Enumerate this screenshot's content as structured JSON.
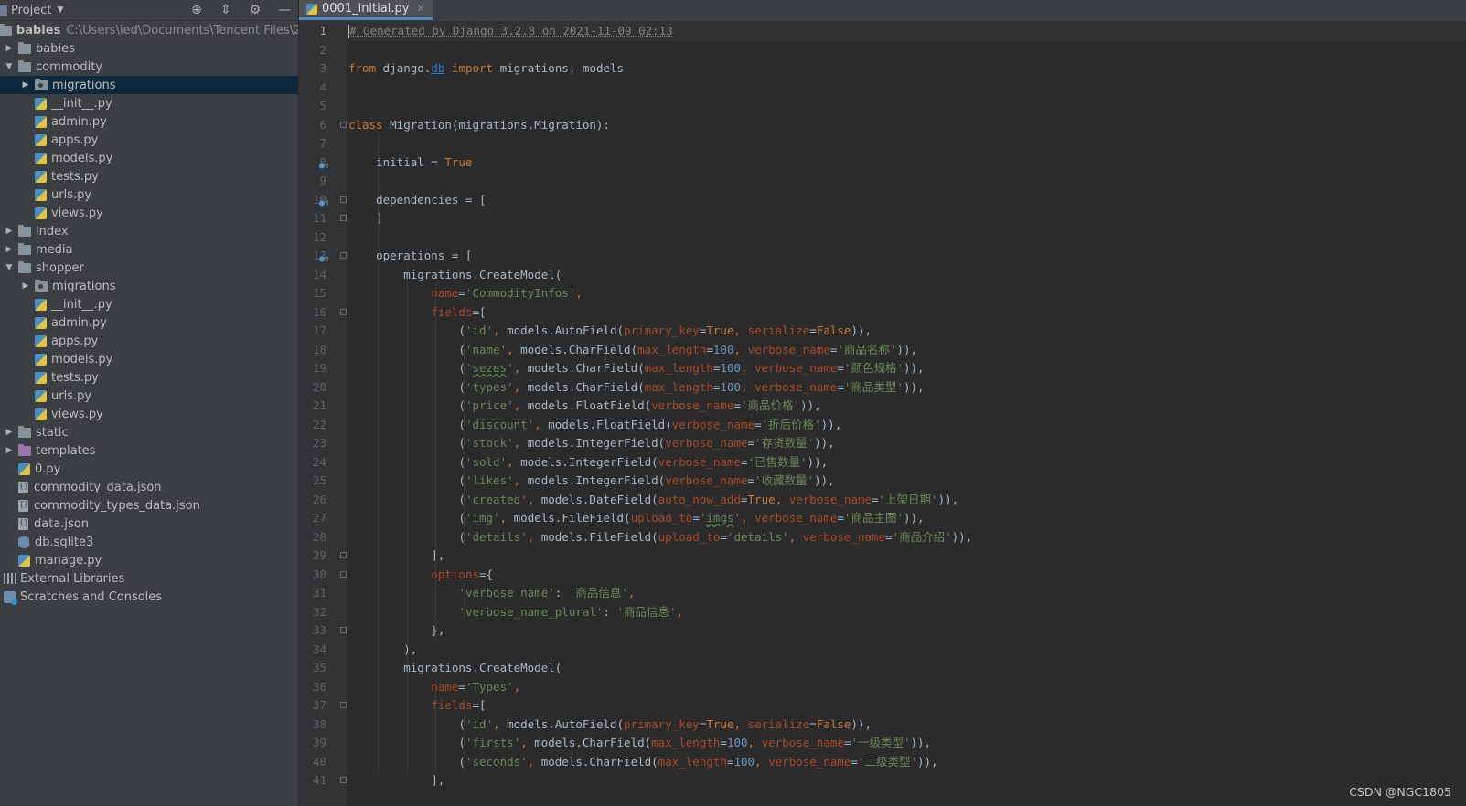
{
  "sidebar": {
    "title": "Project",
    "root_name": "babies",
    "root_path": "C:\\Users\\ied\\Documents\\Tencent Files\\2033(",
    "items": [
      {
        "label": "babies",
        "type": "folder",
        "depth": 1,
        "arrow": "right"
      },
      {
        "label": "commodity",
        "type": "folder",
        "depth": 1,
        "arrow": "down"
      },
      {
        "label": "migrations",
        "type": "pkg",
        "depth": 2,
        "arrow": "right",
        "selected": true
      },
      {
        "label": "__init__.py",
        "type": "py",
        "depth": 2
      },
      {
        "label": "admin.py",
        "type": "py",
        "depth": 2
      },
      {
        "label": "apps.py",
        "type": "py",
        "depth": 2
      },
      {
        "label": "models.py",
        "type": "py",
        "depth": 2
      },
      {
        "label": "tests.py",
        "type": "py",
        "depth": 2
      },
      {
        "label": "urls.py",
        "type": "py",
        "depth": 2
      },
      {
        "label": "views.py",
        "type": "py",
        "depth": 2
      },
      {
        "label": "index",
        "type": "folder",
        "depth": 1,
        "arrow": "right"
      },
      {
        "label": "media",
        "type": "folder",
        "depth": 1,
        "arrow": "right"
      },
      {
        "label": "shopper",
        "type": "folder",
        "depth": 1,
        "arrow": "down"
      },
      {
        "label": "migrations",
        "type": "pkg",
        "depth": 2,
        "arrow": "right"
      },
      {
        "label": "__init__.py",
        "type": "py",
        "depth": 2
      },
      {
        "label": "admin.py",
        "type": "py",
        "depth": 2
      },
      {
        "label": "apps.py",
        "type": "py",
        "depth": 2
      },
      {
        "label": "models.py",
        "type": "py",
        "depth": 2
      },
      {
        "label": "tests.py",
        "type": "py",
        "depth": 2
      },
      {
        "label": "urls.py",
        "type": "py",
        "depth": 2
      },
      {
        "label": "views.py",
        "type": "py",
        "depth": 2
      },
      {
        "label": "static",
        "type": "folder",
        "depth": 1,
        "arrow": "right"
      },
      {
        "label": "templates",
        "type": "tpl",
        "depth": 1,
        "arrow": "right"
      },
      {
        "label": "0.py",
        "type": "py",
        "depth": 1
      },
      {
        "label": "commodity_data.json",
        "type": "json",
        "depth": 1
      },
      {
        "label": "commodity_types_data.json",
        "type": "json",
        "depth": 1
      },
      {
        "label": "data.json",
        "type": "json",
        "depth": 1
      },
      {
        "label": "db.sqlite3",
        "type": "db",
        "depth": 1
      },
      {
        "label": "manage.py",
        "type": "py",
        "depth": 1
      }
    ],
    "external_libraries": "External Libraries",
    "scratches": "Scratches and Consoles"
  },
  "editor": {
    "tab_label": "0001_initial.py",
    "lines": [
      [
        [
          "com",
          "# Generated by Django 3.2.8 on 2021-11-09 02:13"
        ]
      ],
      [],
      [
        [
          "kw",
          "from "
        ],
        [
          "t",
          "django."
        ],
        [
          "link",
          "db"
        ],
        [
          "kw",
          " import "
        ],
        [
          "t",
          "migrations, models"
        ]
      ],
      [],
      [],
      [
        [
          "kw",
          "class "
        ],
        [
          "t",
          "Migration(migrations.Migration):"
        ]
      ],
      [],
      [
        [
          "t",
          "    initial = "
        ],
        [
          "kw",
          "True"
        ]
      ],
      [],
      [
        [
          "t",
          "    dependencies = ["
        ]
      ],
      [
        [
          "t",
          "    ]"
        ]
      ],
      [],
      [
        [
          "t",
          "    operations = ["
        ]
      ],
      [
        [
          "t",
          "        migrations.CreateModel("
        ]
      ],
      [
        [
          "t",
          "            "
        ],
        [
          "param",
          "name"
        ],
        [
          "t",
          "="
        ],
        [
          "str",
          "'CommodityInfos'"
        ],
        [
          "kw",
          ","
        ]
      ],
      [
        [
          "t",
          "            "
        ],
        [
          "param",
          "fields"
        ],
        [
          "t",
          "=["
        ]
      ],
      [
        [
          "t",
          "                ("
        ],
        [
          "str",
          "'id'"
        ],
        [
          "kw",
          ", "
        ],
        [
          "t",
          "models.AutoField("
        ],
        [
          "param",
          "primary_key"
        ],
        [
          "t",
          "="
        ],
        [
          "kw",
          "True"
        ],
        [
          "kw",
          ", "
        ],
        [
          "param",
          "serialize"
        ],
        [
          "t",
          "="
        ],
        [
          "kw",
          "False"
        ],
        [
          "t",
          ")),"
        ]
      ],
      [
        [
          "t",
          "                ("
        ],
        [
          "str",
          "'name'"
        ],
        [
          "kw",
          ", "
        ],
        [
          "t",
          "models.CharField("
        ],
        [
          "param",
          "max_length"
        ],
        [
          "t",
          "="
        ],
        [
          "num",
          "100"
        ],
        [
          "kw",
          ", "
        ],
        [
          "param",
          "verbose_name"
        ],
        [
          "t",
          "="
        ],
        [
          "str",
          "'商品名称'"
        ],
        [
          "t",
          ")),"
        ]
      ],
      [
        [
          "t",
          "                ("
        ],
        [
          "str",
          "'"
        ],
        [
          "wstr",
          "sezes"
        ],
        [
          "str",
          "'"
        ],
        [
          "kw",
          ", "
        ],
        [
          "t",
          "models.CharField("
        ],
        [
          "param",
          "max_length"
        ],
        [
          "t",
          "="
        ],
        [
          "num",
          "100"
        ],
        [
          "kw",
          ", "
        ],
        [
          "param",
          "verbose_name"
        ],
        [
          "t",
          "="
        ],
        [
          "str",
          "'颜色规格'"
        ],
        [
          "t",
          ")),"
        ]
      ],
      [
        [
          "t",
          "                ("
        ],
        [
          "str",
          "'types'"
        ],
        [
          "kw",
          ", "
        ],
        [
          "t",
          "models.CharField("
        ],
        [
          "param",
          "max_length"
        ],
        [
          "t",
          "="
        ],
        [
          "num",
          "100"
        ],
        [
          "kw",
          ", "
        ],
        [
          "param",
          "verbose_name"
        ],
        [
          "t",
          "="
        ],
        [
          "str",
          "'商品类型'"
        ],
        [
          "t",
          ")),"
        ]
      ],
      [
        [
          "t",
          "                ("
        ],
        [
          "str",
          "'price'"
        ],
        [
          "kw",
          ", "
        ],
        [
          "t",
          "models.FloatField("
        ],
        [
          "param",
          "verbose_name"
        ],
        [
          "t",
          "="
        ],
        [
          "str",
          "'商品价格'"
        ],
        [
          "t",
          ")),"
        ]
      ],
      [
        [
          "t",
          "                ("
        ],
        [
          "str",
          "'discount'"
        ],
        [
          "kw",
          ", "
        ],
        [
          "t",
          "models.FloatField("
        ],
        [
          "param",
          "verbose_name"
        ],
        [
          "t",
          "="
        ],
        [
          "str",
          "'折后价格'"
        ],
        [
          "t",
          ")),"
        ]
      ],
      [
        [
          "t",
          "                ("
        ],
        [
          "str",
          "'stock'"
        ],
        [
          "kw",
          ", "
        ],
        [
          "t",
          "models.IntegerField("
        ],
        [
          "param",
          "verbose_name"
        ],
        [
          "t",
          "="
        ],
        [
          "str",
          "'存货数量'"
        ],
        [
          "t",
          ")),"
        ]
      ],
      [
        [
          "t",
          "                ("
        ],
        [
          "str",
          "'sold'"
        ],
        [
          "kw",
          ", "
        ],
        [
          "t",
          "models.IntegerField("
        ],
        [
          "param",
          "verbose_name"
        ],
        [
          "t",
          "="
        ],
        [
          "str",
          "'已售数量'"
        ],
        [
          "t",
          ")),"
        ]
      ],
      [
        [
          "t",
          "                ("
        ],
        [
          "str",
          "'likes'"
        ],
        [
          "kw",
          ", "
        ],
        [
          "t",
          "models.IntegerField("
        ],
        [
          "param",
          "verbose_name"
        ],
        [
          "t",
          "="
        ],
        [
          "str",
          "'收藏数量'"
        ],
        [
          "t",
          ")),"
        ]
      ],
      [
        [
          "t",
          "                ("
        ],
        [
          "str",
          "'created'"
        ],
        [
          "kw",
          ", "
        ],
        [
          "t",
          "models.DateField("
        ],
        [
          "param",
          "auto_now_add"
        ],
        [
          "t",
          "="
        ],
        [
          "kw",
          "True"
        ],
        [
          "kw",
          ", "
        ],
        [
          "param",
          "verbose_name"
        ],
        [
          "t",
          "="
        ],
        [
          "str",
          "'上架日期'"
        ],
        [
          "t",
          ")),"
        ]
      ],
      [
        [
          "t",
          "                ("
        ],
        [
          "str",
          "'img'"
        ],
        [
          "kw",
          ", "
        ],
        [
          "t",
          "models.FileField("
        ],
        [
          "param",
          "upload_to"
        ],
        [
          "t",
          "="
        ],
        [
          "str",
          "'"
        ],
        [
          "wstr",
          "imgs"
        ],
        [
          "str",
          "'"
        ],
        [
          "kw",
          ", "
        ],
        [
          "param",
          "verbose_name"
        ],
        [
          "t",
          "="
        ],
        [
          "str",
          "'商品主图'"
        ],
        [
          "t",
          ")),"
        ]
      ],
      [
        [
          "t",
          "                ("
        ],
        [
          "str",
          "'details'"
        ],
        [
          "kw",
          ", "
        ],
        [
          "t",
          "models.FileField("
        ],
        [
          "param",
          "upload_to"
        ],
        [
          "t",
          "="
        ],
        [
          "str",
          "'details'"
        ],
        [
          "kw",
          ", "
        ],
        [
          "param",
          "verbose_name"
        ],
        [
          "t",
          "="
        ],
        [
          "str",
          "'商品介绍'"
        ],
        [
          "t",
          ")),"
        ]
      ],
      [
        [
          "t",
          "            ],"
        ]
      ],
      [
        [
          "t",
          "            "
        ],
        [
          "param",
          "options"
        ],
        [
          "t",
          "={"
        ]
      ],
      [
        [
          "t",
          "                "
        ],
        [
          "str",
          "'verbose_name'"
        ],
        [
          "t",
          ": "
        ],
        [
          "str",
          "'商品信息'"
        ],
        [
          "kw",
          ","
        ]
      ],
      [
        [
          "t",
          "                "
        ],
        [
          "str",
          "'verbose_name_plural'"
        ],
        [
          "t",
          ": "
        ],
        [
          "str",
          "'商品信息'"
        ],
        [
          "kw",
          ","
        ]
      ],
      [
        [
          "t",
          "            },"
        ]
      ],
      [
        [
          "t",
          "        ),"
        ]
      ],
      [
        [
          "t",
          "        migrations.CreateModel("
        ]
      ],
      [
        [
          "t",
          "            "
        ],
        [
          "param",
          "name"
        ],
        [
          "t",
          "="
        ],
        [
          "str",
          "'Types'"
        ],
        [
          "kw",
          ","
        ]
      ],
      [
        [
          "t",
          "            "
        ],
        [
          "param",
          "fields"
        ],
        [
          "t",
          "=["
        ]
      ],
      [
        [
          "t",
          "                ("
        ],
        [
          "str",
          "'id'"
        ],
        [
          "kw",
          ", "
        ],
        [
          "t",
          "models.AutoField("
        ],
        [
          "param",
          "primary_key"
        ],
        [
          "t",
          "="
        ],
        [
          "kw",
          "True"
        ],
        [
          "kw",
          ", "
        ],
        [
          "param",
          "serialize"
        ],
        [
          "t",
          "="
        ],
        [
          "kw",
          "False"
        ],
        [
          "t",
          ")),"
        ]
      ],
      [
        [
          "t",
          "                ("
        ],
        [
          "str",
          "'firsts'"
        ],
        [
          "kw",
          ", "
        ],
        [
          "t",
          "models.CharField("
        ],
        [
          "param",
          "max_length"
        ],
        [
          "t",
          "="
        ],
        [
          "num",
          "100"
        ],
        [
          "kw",
          ", "
        ],
        [
          "param",
          "verbose_name"
        ],
        [
          "t",
          "="
        ],
        [
          "str",
          "'一级类型'"
        ],
        [
          "t",
          ")),"
        ]
      ],
      [
        [
          "t",
          "                ("
        ],
        [
          "str",
          "'seconds'"
        ],
        [
          "kw",
          ", "
        ],
        [
          "t",
          "models.CharField("
        ],
        [
          "param",
          "max_length"
        ],
        [
          "t",
          "="
        ],
        [
          "num",
          "100"
        ],
        [
          "kw",
          ", "
        ],
        [
          "param",
          "verbose_name"
        ],
        [
          "t",
          "="
        ],
        [
          "str",
          "'二级类型'"
        ],
        [
          "t",
          ")),"
        ]
      ],
      [
        [
          "t",
          "            ],"
        ]
      ]
    ]
  },
  "watermark": "CSDN @NGC1805"
}
